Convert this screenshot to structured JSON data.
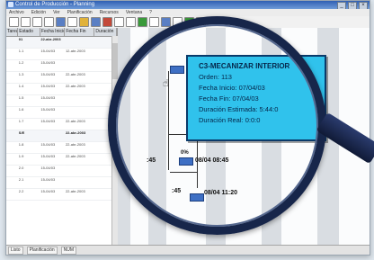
{
  "window": {
    "title": "Control de Producción - Planning",
    "min": "_",
    "max": "□",
    "close": "×"
  },
  "menu": [
    "Archivo",
    "Edición",
    "Ver",
    "Planificación",
    "Recursos",
    "Ventana",
    "?"
  ],
  "grid": {
    "headers": [
      "Tarea",
      "Estado",
      "Fecha Inicio",
      "Fecha Fin",
      "Duración"
    ],
    "rows": [
      [
        "",
        "01",
        "22-abr-2003",
        "",
        ""
      ],
      [
        "",
        "1.1",
        "15-04/03",
        "12-abr-2003",
        ""
      ],
      [
        "",
        "1.2",
        "15-04/03",
        "",
        ""
      ],
      [
        "",
        "1.3",
        "15-04/03",
        "22-abr-2003",
        ""
      ],
      [
        "",
        "1.4",
        "15-04/03",
        "22-abr-2003",
        ""
      ],
      [
        "",
        "1.5",
        "15-04/03",
        "",
        ""
      ],
      [
        "",
        "1.6",
        "15-04/03",
        "",
        ""
      ],
      [
        "",
        "1.7",
        "15-04/03",
        "22-abr-2003",
        ""
      ],
      [
        "",
        "S/E",
        "",
        "22-abr-2003",
        ""
      ],
      [
        "",
        "1.8",
        "15-04/03",
        "22-abr-2003",
        ""
      ],
      [
        "",
        "1.9",
        "15-04/03",
        "22-abr-2003",
        ""
      ],
      [
        "",
        "2.0",
        "15-04/03",
        "",
        ""
      ],
      [
        "",
        "2.1",
        "15-04/03",
        "",
        ""
      ],
      [
        "",
        "2.2",
        "15-04/03",
        "22-abr-2003",
        ""
      ]
    ]
  },
  "gantt": {
    "label_0845": "08/04 08:45",
    "label_1120": "08/04 11:20",
    "label_pct": "0%",
    "label_left1": ":45",
    "label_left2": ":45"
  },
  "popup": {
    "title": "C3-MECANIZAR INTERIOR",
    "orden": "Orden: 113",
    "inicio": "Fecha Inicio: 07/04/03",
    "fin": "Fecha Fin: 07/04/03",
    "estimada": "Duración Estimada: 5:44:0",
    "real": "Duración Real: 0:0:0"
  },
  "status": {
    "left": "Listo",
    "center": "Planificación",
    "right": "NUM"
  },
  "colors": {
    "accent": "#30c2ec",
    "node": "#3e6fc4",
    "magnifier": "#17264a"
  }
}
